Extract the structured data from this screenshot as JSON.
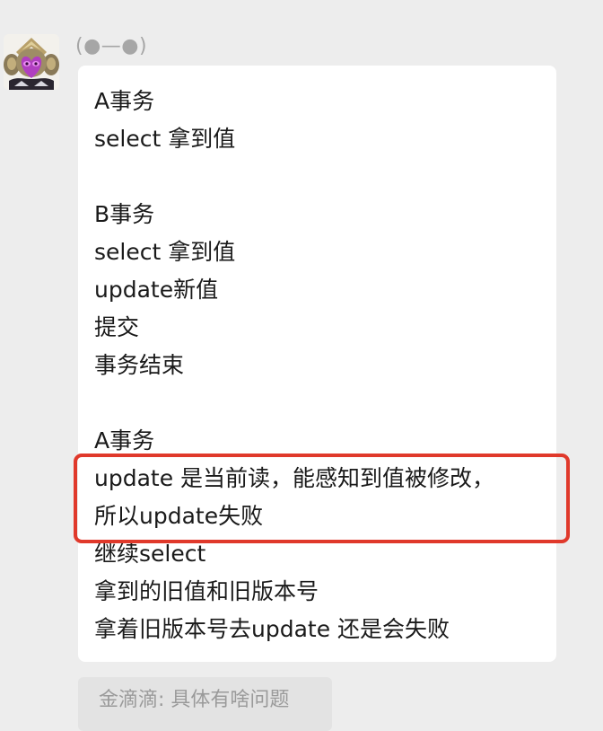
{
  "chat": {
    "sender": {
      "name": "(●—●)"
    },
    "message": {
      "lines": [
        "A事务",
        "select 拿到值",
        "",
        "B事务",
        "select 拿到值",
        "update新值",
        "提交",
        "事务结束",
        "",
        "A事务",
        "update 是当前读，能感知到值被修改，",
        "所以update失败",
        "继续select",
        "拿到的旧值和旧版本号",
        "拿着旧版本号去update 还是会失败"
      ]
    },
    "quoted_reply": {
      "text": "金滴滴: 具体有啥问题"
    },
    "highlight_color": "#e0392b"
  }
}
